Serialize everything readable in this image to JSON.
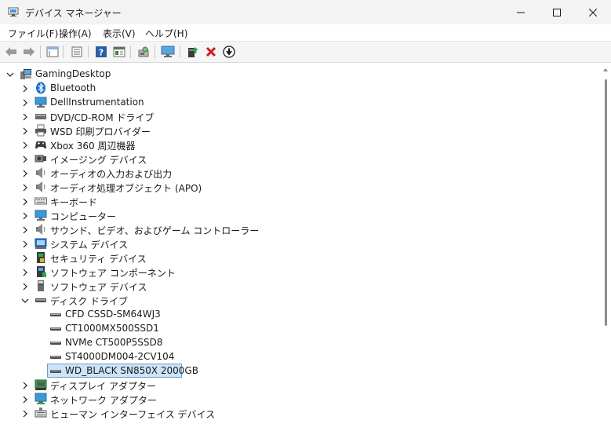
{
  "window": {
    "title": "デバイス マネージャー"
  },
  "menu": [
    {
      "label": "ファイル(F)"
    },
    {
      "label": "操作(A)"
    },
    {
      "label": "表示(V)"
    },
    {
      "label": "ヘルプ(H)"
    }
  ],
  "toolbar": {
    "buttons": [
      "back-icon",
      "forward-icon",
      "properties-icon",
      "list-view-icon",
      "help-icon",
      "properties-sheet-icon",
      "scan-hardware-icon",
      "monitor-icon",
      "update-driver-icon",
      "uninstall-icon",
      "disable-icon"
    ]
  },
  "tree": {
    "root": {
      "label": "GamingDesktop",
      "expanded": true,
      "icon": "computer-icon"
    },
    "items": [
      {
        "label": "Bluetooth",
        "icon": "bluetooth-icon",
        "expanded": false
      },
      {
        "label": "DellInstrumentation",
        "icon": "monitor-icon",
        "expanded": false
      },
      {
        "label": "DVD/CD-ROM ドライブ",
        "icon": "dvd-drive-icon",
        "expanded": false
      },
      {
        "label": "WSD 印刷プロバイダー",
        "icon": "printer-icon",
        "expanded": false
      },
      {
        "label": "Xbox 360 周辺機器",
        "icon": "gamepad-icon",
        "expanded": false
      },
      {
        "label": "イメージング デバイス",
        "icon": "camera-icon",
        "expanded": false
      },
      {
        "label": "オーディオの入力および出力",
        "icon": "speaker-icon",
        "expanded": false
      },
      {
        "label": "オーディオ処理オブジェクト (APO)",
        "icon": "speaker-icon",
        "expanded": false
      },
      {
        "label": "キーボード",
        "icon": "keyboard-icon",
        "expanded": false
      },
      {
        "label": "コンピューター",
        "icon": "monitor-icon",
        "expanded": false
      },
      {
        "label": "サウンド、ビデオ、およびゲーム コントローラー",
        "icon": "speaker-icon",
        "expanded": false
      },
      {
        "label": "システム デバイス",
        "icon": "system-device-icon",
        "expanded": false
      },
      {
        "label": "セキュリティ デバイス",
        "icon": "security-device-icon",
        "expanded": false
      },
      {
        "label": "ソフトウェア コンポーネント",
        "icon": "software-component-icon",
        "expanded": false
      },
      {
        "label": "ソフトウェア デバイス",
        "icon": "software-device-icon",
        "expanded": false
      },
      {
        "label": "ディスク ドライブ",
        "icon": "disk-drive-icon",
        "expanded": true,
        "children": [
          {
            "label": "CFD CSSD-SM64WJ3",
            "selected": false
          },
          {
            "label": "CT1000MX500SSD1",
            "selected": false
          },
          {
            "label": "NVMe CT500P5SSD8",
            "selected": false
          },
          {
            "label": "ST4000DM004-2CV104",
            "selected": false
          },
          {
            "label": "WD_BLACK SN850X 2000GB",
            "selected": true
          }
        ]
      },
      {
        "label": "ディスプレイ アダプター",
        "icon": "display-adapter-icon",
        "expanded": false
      },
      {
        "label": "ネットワーク アダプター",
        "icon": "network-adapter-icon",
        "expanded": false
      },
      {
        "label": "ヒューマン インターフェイス デバイス",
        "icon": "hid-icon",
        "expanded": false
      }
    ]
  },
  "colors": {
    "accent": "#0067c0",
    "selection": "#cce4f7",
    "selection_border": "#6b9fd1"
  }
}
